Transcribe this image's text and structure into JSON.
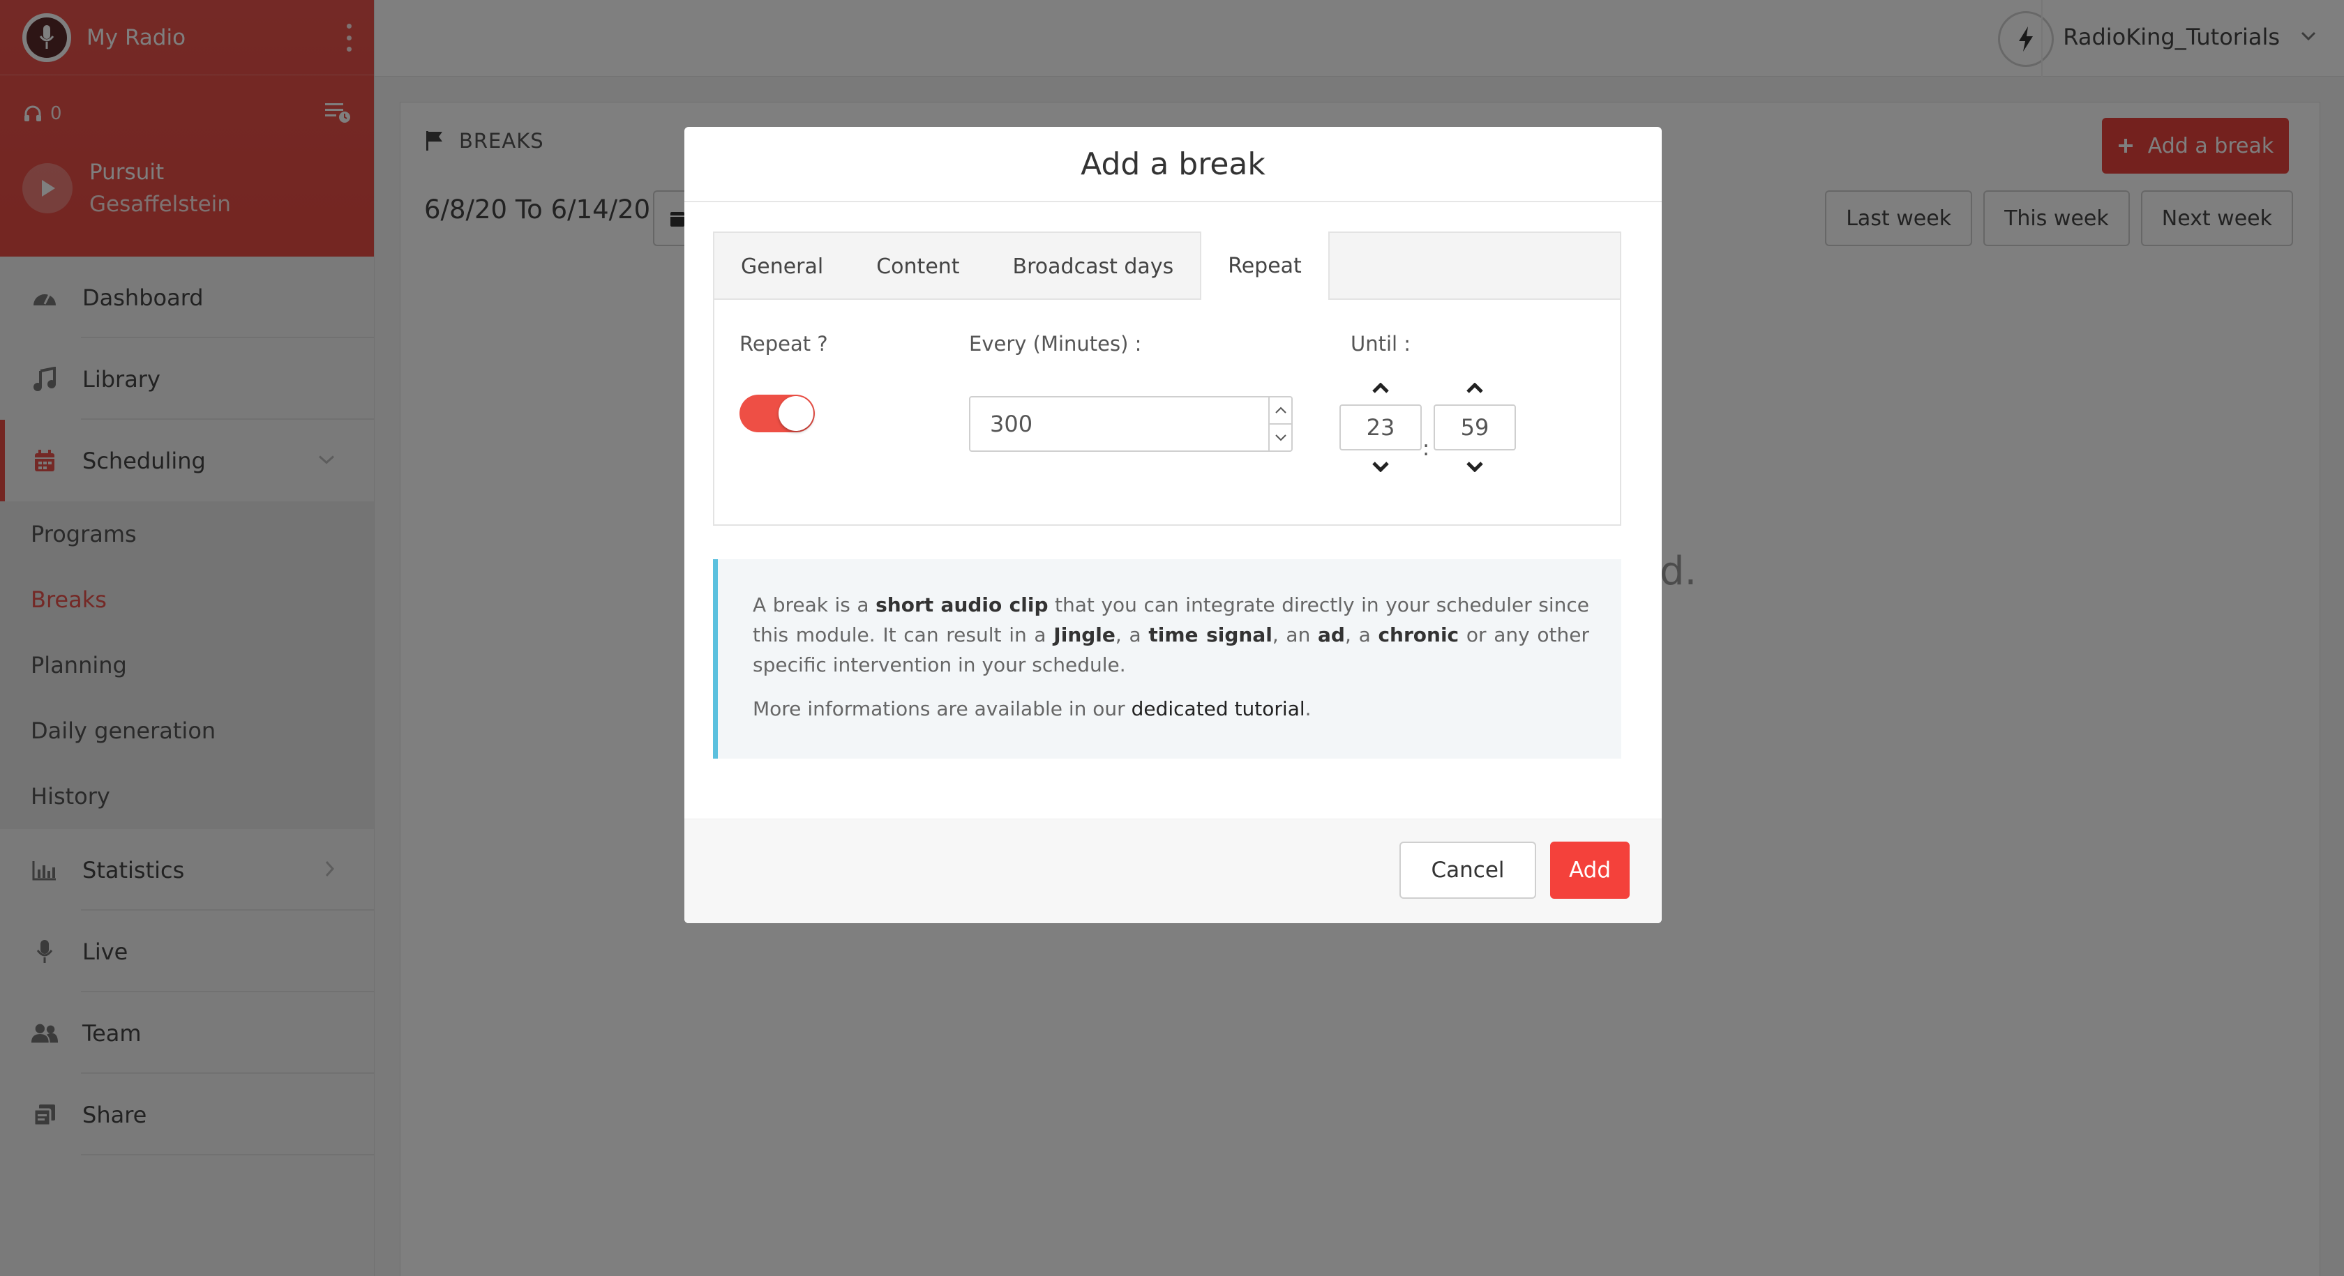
{
  "sidebar": {
    "radio_name": "My Radio",
    "listeners": "0",
    "track_title": "Pursuit",
    "track_artist": "Gesaffelstein",
    "nav": {
      "dashboard": "Dashboard",
      "library": "Library",
      "scheduling": "Scheduling",
      "statistics": "Statistics",
      "live": "Live",
      "team": "Team",
      "share": "Share"
    },
    "scheduling_sub": {
      "programs": "Programs",
      "breaks": "Breaks",
      "planning": "Planning",
      "daily_generation": "Daily generation",
      "history": "History"
    }
  },
  "topbar": {
    "user_name": "RadioKing_Tutorials"
  },
  "panel": {
    "section_title": "BREAKS",
    "add_break_label": "Add a break",
    "date_range": "6/8/20 To 6/14/20",
    "last_week": "Last week",
    "this_week": "This week",
    "next_week": "Next week",
    "bg_fragment": "d."
  },
  "modal": {
    "title": "Add a break",
    "tabs": {
      "general": "General",
      "content": "Content",
      "broadcast_days": "Broadcast days",
      "repeat": "Repeat"
    },
    "repeat_label": "Repeat ?",
    "repeat_enabled": true,
    "every_label": "Every (Minutes) :",
    "every_value": "300",
    "until_label": "Until :",
    "until_hour": "23",
    "until_minute": "59",
    "time_separator": ":",
    "info": {
      "t1": "A break is a ",
      "b1": "short audio clip",
      "t2": " that you can integrate directly in your scheduler since this module. It can result in a ",
      "b2": "Jingle",
      "t3": ", a ",
      "b3": "time signal",
      "t4": ", an ",
      "b4": "ad",
      "t5": ", a ",
      "b5": "chronic",
      "t6": " or any other specific intervention in your schedule.",
      "more_prefix": "More informations are available in our ",
      "more_link": "dedicated tutorial",
      "more_suffix": "."
    },
    "cancel_label": "Cancel",
    "add_label": "Add"
  },
  "colors": {
    "brand_red": "#e8534c",
    "toggle_on": "#ee4f45",
    "info_accent": "#5bc0de"
  }
}
